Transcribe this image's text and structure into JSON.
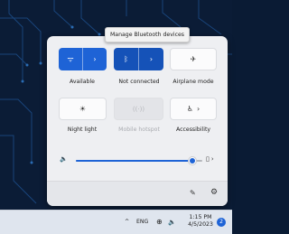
{
  "tooltip": "Manage Bluetooth devices",
  "quick_settings": {
    "tiles": [
      {
        "label": "Available",
        "icon": "wifi-icon",
        "state": "on"
      },
      {
        "label": "Not connected",
        "icon": "bluetooth-icon",
        "state": "on"
      },
      {
        "label": "Airplane mode",
        "icon": "airplane-icon",
        "state": "off"
      },
      {
        "label": "Night light",
        "icon": "night-light-icon",
        "state": "off"
      },
      {
        "label": "Mobile hotspot",
        "icon": "hotspot-icon",
        "state": "disabled"
      },
      {
        "label": "Accessibility",
        "icon": "accessibility-icon",
        "state": "off"
      }
    ],
    "volume": {
      "level": 0.92
    },
    "icons": {
      "wifi": "ᯤ",
      "chevron": "›",
      "bluetooth": "ᛒ",
      "airplane": "✈",
      "night": "☀",
      "hotspot": "((·))",
      "accessibility": "♿",
      "speaker": "🔈",
      "edit": "✎",
      "gear": "⚙",
      "audio_output": "▯"
    }
  },
  "taskbar": {
    "chevron_up": "^",
    "language": "ENG",
    "network_icon": "⊕",
    "volume_icon": "🔈",
    "time": "1:15 PM",
    "date": "4/5/2023",
    "notification_count": "2"
  },
  "colors": {
    "accent": "#1e63d6",
    "panel": "#eeeff2"
  }
}
